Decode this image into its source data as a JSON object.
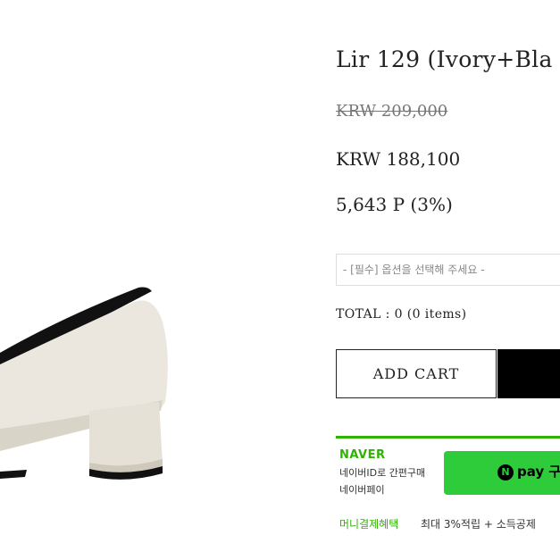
{
  "product": {
    "title": "Lir 129 (Ivory+Bla",
    "original_price": "KRW 209,000",
    "sale_price": "KRW 188,100",
    "points": "5,643 P (3%)"
  },
  "option": {
    "placeholder": "- [필수] 옵션을 선택해 주세요 -"
  },
  "total": {
    "label": "TOTAL : 0 (0 items)"
  },
  "actions": {
    "add_cart_label": "ADD CART"
  },
  "naver": {
    "logo": "NAVER",
    "line1": "네이버ID로 간편구매",
    "line2": "네이버페이",
    "pay_icon_letter": "N",
    "pay_label": "pay 구",
    "benefit_label": "머니결제혜택",
    "benefit_desc": "최대 3%적립 + 소득공제"
  },
  "colors": {
    "naver_green": "#2db400",
    "pay_button": "#2ecc3a",
    "buy_now": "#000000"
  }
}
